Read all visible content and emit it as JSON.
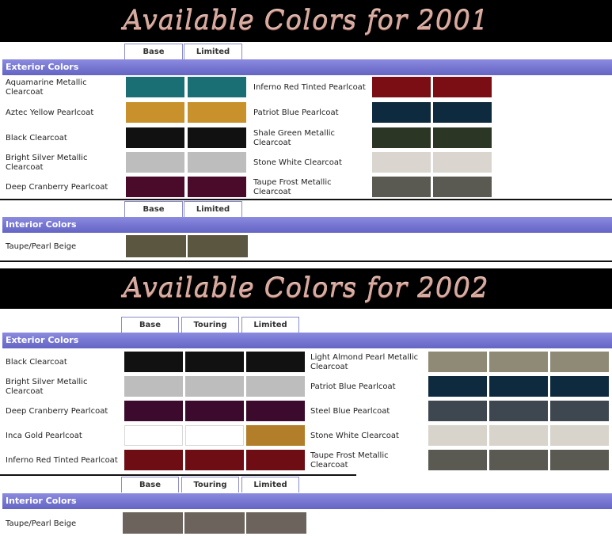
{
  "years": [
    {
      "title": "Available Colors for 2001",
      "trims": [
        "Base",
        "Limited"
      ],
      "exterior_header": "Exterior Colors",
      "exterior_left": [
        {
          "name": "Aquamarine Metallic Clearcoat",
          "colors": [
            "#1a6f74",
            "#1a6f74"
          ]
        },
        {
          "name": "Aztec Yellow Pearlcoat",
          "colors": [
            "#c8912c",
            "#c8912c"
          ]
        },
        {
          "name": "Black Clearcoat",
          "colors": [
            "#111111",
            "#111111"
          ]
        },
        {
          "name": "Bright Silver Metallic Clearcoat",
          "colors": [
            "#bdbdbd",
            "#bdbdbd"
          ]
        },
        {
          "name": "Deep Cranberry Pearlcoat",
          "colors": [
            "#4a0a2a",
            "#4a0a2a"
          ]
        }
      ],
      "exterior_right": [
        {
          "name": "Inferno Red Tinted Pearlcoat",
          "colors": [
            "#7a0e14",
            "#7a0e14"
          ]
        },
        {
          "name": "Patriot Blue Pearlcoat",
          "colors": [
            "#0e2a3e",
            "#0e2a3e"
          ]
        },
        {
          "name": "Shale Green Metallic Clearcoat",
          "colors": [
            "#2c3624",
            "#2c3624"
          ]
        },
        {
          "name": "Stone White Clearcoat",
          "colors": [
            "#dad6cf",
            "#dad6cf"
          ]
        },
        {
          "name": "Taupe Frost Metallic Clearcoat",
          "colors": [
            "#5b5a52",
            "#5b5a52"
          ]
        }
      ],
      "interior_header": "Interior Colors",
      "interior": [
        {
          "name": "Taupe/Pearl Beige",
          "colors": [
            "#5a563f",
            "#5a563f"
          ]
        }
      ]
    },
    {
      "title": "Available Colors for 2002",
      "trims": [
        "Base",
        "Touring",
        "Limited"
      ],
      "exterior_header": "Exterior Colors",
      "exterior_left": [
        {
          "name": "Black Clearcoat",
          "colors": [
            "#111111",
            "#111111",
            "#111111"
          ]
        },
        {
          "name": "Bright Silver Metallic Clearcoat",
          "colors": [
            "#bdbdbd",
            "#bdbdbd",
            "#bdbdbd"
          ]
        },
        {
          "name": "Deep Cranberry Pearlcoat",
          "colors": [
            "#3c0a2c",
            "#3c0a2c",
            "#3c0a2c"
          ]
        },
        {
          "name": "Inca Gold Pearlcoat",
          "colors": [
            "#ffffff",
            "#ffffff",
            "#b37e2a"
          ]
        },
        {
          "name": "Inferno Red Tinted Pearlcoat",
          "colors": [
            "#6e0e14",
            "#6e0e14",
            "#6e0e14"
          ]
        }
      ],
      "exterior_right": [
        {
          "name": "Light Almond Pearl Metallic Clearcoat",
          "colors": [
            "#8e8a76",
            "#8e8a76",
            "#8e8a76"
          ]
        },
        {
          "name": "Patriot Blue Pearlcoat",
          "colors": [
            "#0e2a3e",
            "#0e2a3e",
            "#0e2a3e"
          ]
        },
        {
          "name": "Steel Blue Pearlcoat",
          "colors": [
            "#3e4650",
            "#3e4650",
            "#3e4650"
          ]
        },
        {
          "name": "Stone White Clearcoat",
          "colors": [
            "#d8d4cc",
            "#d8d4cc",
            "#d8d4cc"
          ]
        },
        {
          "name": "Taupe Frost Metallic Clearcoat",
          "colors": [
            "#5a5a52",
            "#5a5a52",
            "#5a5a52"
          ]
        }
      ],
      "interior_header": "Interior Colors",
      "interior": [
        {
          "name": "Taupe/Pearl Beige",
          "colors": [
            "#6b635c",
            "#6b635c",
            "#6b635c"
          ]
        }
      ]
    }
  ]
}
